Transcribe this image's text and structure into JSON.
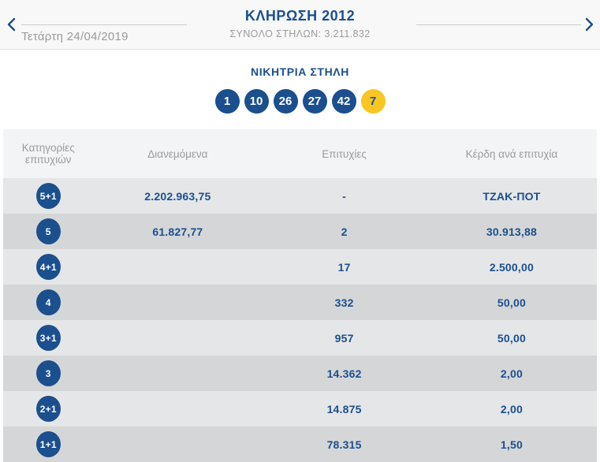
{
  "header": {
    "title": "ΚΛΗΡΩΣΗ 2012",
    "subtitle": "ΣΥΝΟΛΟ ΣΤΗΛΩΝ: 3.211.832",
    "date": "Τετάρτη 24/04/2019"
  },
  "winning": {
    "heading": "ΝΙΚΗΤΡΙΑ ΣΤΗΛΗ",
    "numbers": [
      "1",
      "10",
      "26",
      "27",
      "42"
    ],
    "bonus": "7"
  },
  "table": {
    "columns": [
      "Κατηγορίες επιτυχιών",
      "Διανεμόμενα",
      "Επιτυχίες",
      "Κέρδη ανά επιτυχία"
    ],
    "rows": [
      {
        "category": "5+1",
        "distributed": "2.202.963,75",
        "winners": "-",
        "prize": "ΤΖΑΚ-ΠΟΤ"
      },
      {
        "category": "5",
        "distributed": "61.827,77",
        "winners": "2",
        "prize": "30.913,88"
      },
      {
        "category": "4+1",
        "distributed": "",
        "winners": "17",
        "prize": "2.500,00"
      },
      {
        "category": "4",
        "distributed": "",
        "winners": "332",
        "prize": "50,00"
      },
      {
        "category": "3+1",
        "distributed": "",
        "winners": "957",
        "prize": "50,00"
      },
      {
        "category": "3",
        "distributed": "",
        "winners": "14.362",
        "prize": "2,00"
      },
      {
        "category": "2+1",
        "distributed": "",
        "winners": "14.875",
        "prize": "2,00"
      },
      {
        "category": "1+1",
        "distributed": "",
        "winners": "78.315",
        "prize": "1,50"
      }
    ]
  },
  "colors": {
    "navy": "#1b4f8e",
    "bonus_yellow": "#f9c623",
    "muted_text": "#9b9b9b",
    "row_light": "#e5e6e7",
    "row_dark": "#d5d6d7",
    "table_header_bg": "#f3f4f5"
  }
}
